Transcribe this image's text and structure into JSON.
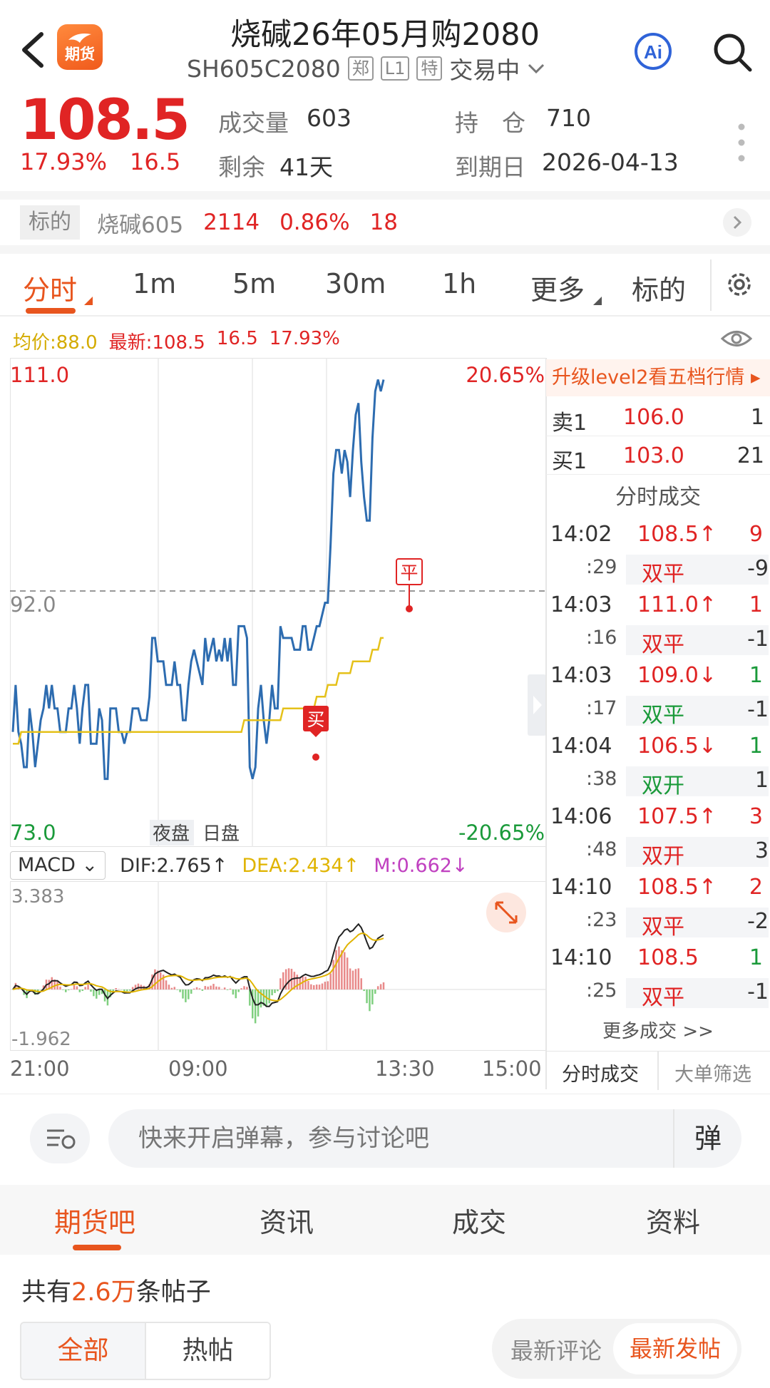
{
  "header": {
    "title": "烧碱26年05月购2080",
    "code": "SH605C2080",
    "tags": [
      "郑",
      "L1",
      "特"
    ],
    "status": "交易中",
    "logo_text": "期货",
    "ai_label": "Ai"
  },
  "quote": {
    "price": "108.5",
    "change_pct": "17.93%",
    "change_abs": "16.5",
    "volume_label": "成交量",
    "volume": "603",
    "oi_label": "持　仓",
    "oi": "710",
    "remain_label": "剩余",
    "remain": "41天",
    "expiry_label": "到期日",
    "expiry": "2026-04-13"
  },
  "underlying": {
    "tag": "标的",
    "name": "烧碱605",
    "price": "2114",
    "pct": "0.86%",
    "chg": "18"
  },
  "period_tabs": [
    "分时",
    "1m",
    "5m",
    "30m",
    "1h",
    "更多",
    "标的"
  ],
  "legend": {
    "avg": "均价:88.0",
    "latest": "最新:108.5",
    "chg": "16.5",
    "pct": "17.93%"
  },
  "chart_labels": {
    "y_max": "111.0",
    "y_mid": "92.0",
    "y_min": "73.0",
    "pct_max": "20.65%",
    "pct_min": "-20.65%",
    "session_night": "夜盘",
    "session_day": "日盘",
    "buy_marker": "买",
    "close_marker": "平",
    "time_ticks": [
      "21:00",
      "09:00",
      "13:30",
      "15:00"
    ]
  },
  "macd": {
    "select": "MACD",
    "dif": "DIF:2.765↑",
    "dea": "DEA:2.434↑",
    "m": "M:0.662↓",
    "y_max": "3.383",
    "y_min": "-1.962"
  },
  "chart_data": {
    "type": "line",
    "ylim": [
      73.0,
      111.0
    ],
    "reference": 92.0,
    "series": [
      {
        "values": [
          80,
          84,
          80,
          79,
          77,
          77,
          82,
          80,
          77,
          79,
          81,
          82,
          84,
          82,
          84,
          82,
          82,
          80,
          80,
          80,
          82,
          82,
          84,
          82,
          79,
          82,
          84,
          84,
          79,
          79,
          79,
          82,
          81,
          76,
          76,
          82,
          82,
          82,
          80,
          80,
          79,
          80,
          80,
          82,
          82,
          82,
          81,
          81,
          81,
          83,
          88,
          88,
          86,
          86,
          86,
          84,
          84,
          84,
          86,
          84,
          84,
          81,
          81,
          84,
          86,
          87,
          86,
          85,
          84,
          88,
          86,
          87,
          88,
          86,
          87,
          86,
          88,
          86,
          88,
          84,
          84,
          89,
          89,
          89,
          88,
          77,
          76,
          77,
          82,
          84,
          81,
          79,
          81,
          84,
          82,
          82,
          89,
          88,
          88,
          88,
          88,
          87,
          87,
          87,
          89,
          89,
          87,
          87,
          88,
          89,
          89,
          90,
          91,
          91,
          96,
          102,
          104,
          104,
          102,
          104,
          103,
          100,
          104,
          107,
          108,
          103,
          100,
          98,
          98,
          105,
          109,
          110,
          109,
          110
        ]
      },
      {
        "values": [
          79,
          79,
          79,
          80,
          80,
          80,
          80,
          80,
          80,
          80,
          80,
          80,
          80,
          80,
          80,
          80,
          80,
          80,
          80,
          80,
          80,
          80,
          80,
          80,
          80,
          80,
          80,
          80,
          80,
          80,
          80,
          80,
          80,
          80,
          80,
          80,
          80,
          80,
          80,
          80,
          80,
          80,
          80,
          80,
          80,
          80,
          80,
          80,
          80,
          80,
          80,
          80,
          80,
          80,
          80,
          80,
          80,
          80,
          80,
          80,
          80,
          80,
          80,
          80,
          80,
          80,
          80,
          80,
          80,
          80,
          80,
          80,
          80,
          80,
          80,
          80,
          80,
          80,
          80,
          80,
          80,
          80,
          80,
          81,
          81,
          81,
          81,
          81,
          81,
          81,
          81,
          81,
          81,
          81,
          81,
          81,
          81,
          82,
          82,
          82,
          82,
          82,
          82,
          82,
          82,
          82,
          82,
          82,
          82,
          83,
          83,
          83,
          83,
          84,
          84,
          84,
          84,
          85,
          85,
          85,
          85,
          85,
          86,
          86,
          86,
          86,
          86,
          86,
          86,
          87,
          87,
          87,
          88,
          88
        ]
      }
    ]
  },
  "right_panel": {
    "upgrade": "升级level2看五档行情 ▸",
    "ask_label": "卖1",
    "ask_price": "106.0",
    "ask_vol": "1",
    "bid_label": "买1",
    "bid_price": "103.0",
    "bid_vol": "21",
    "trades_title": "分时成交",
    "trades": [
      {
        "time": "14:02",
        "sec": ":29",
        "price": "108.5↑",
        "vol": "9",
        "action": "双平",
        "delta": "-9",
        "dir": "up"
      },
      {
        "time": "14:03",
        "sec": ":16",
        "price": "111.0↑",
        "vol": "1",
        "action": "双平",
        "delta": "-1",
        "dir": "up"
      },
      {
        "time": "14:03",
        "sec": ":17",
        "price": "109.0↓",
        "vol": "1",
        "action": "双平",
        "delta": "-1",
        "dir": "down"
      },
      {
        "time": "14:04",
        "sec": ":38",
        "price": "106.5↓",
        "vol": "1",
        "action": "双开",
        "delta": "1",
        "dir": "down"
      },
      {
        "time": "14:06",
        "sec": ":48",
        "price": "107.5↑",
        "vol": "3",
        "action": "双开",
        "delta": "3",
        "dir": "up"
      },
      {
        "time": "14:10",
        "sec": ":23",
        "price": "108.5↑",
        "vol": "2",
        "action": "双平",
        "delta": "-2",
        "dir": "up"
      },
      {
        "time": "14:10",
        "sec": ":25",
        "price": "108.5",
        "vol": "1",
        "action": "双平",
        "delta": "-1",
        "dir": "flat"
      }
    ],
    "more": "更多成交 >>",
    "foot_left": "分时成交",
    "foot_right": "大单筛选"
  },
  "comment": {
    "placeholder": "快来开启弹幕，参与讨论吧",
    "danmu": "弹"
  },
  "bottom_tabs": [
    "期货吧",
    "资讯",
    "成交",
    "资料"
  ],
  "posts": {
    "prefix": "共有",
    "count": "2.6万",
    "suffix": "条帖子",
    "seg_all": "全部",
    "seg_hot": "热帖",
    "sort_comment": "最新评论",
    "sort_post": "最新发帖"
  },
  "colors": {
    "up": "#e02424",
    "down": "#1a9a3a",
    "accent": "#e8551e",
    "price_line": "#2d6cb0",
    "avg_line": "#e5c11a"
  }
}
